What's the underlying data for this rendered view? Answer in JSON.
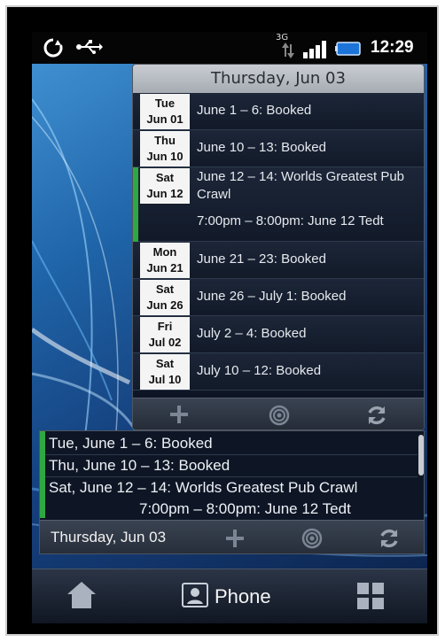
{
  "status_bar": {
    "network": "3G",
    "time": "12:29",
    "icons": [
      "sync-icon",
      "usb-icon",
      "data-arrows-icon",
      "signal-icon",
      "battery-icon"
    ]
  },
  "agenda_widget": {
    "header_date": "Thursday, Jun 03",
    "rows": [
      {
        "day": "Tue",
        "date": "Jun 01",
        "events": [
          "June 1 – 6: Booked"
        ]
      },
      {
        "day": "Thu",
        "date": "Jun 10",
        "events": [
          "June 10 – 13: Booked"
        ]
      },
      {
        "day": "Sat",
        "date": "Jun 12",
        "events": [
          "June 12 – 14: Worlds Greatest Pub",
          "Crawl",
          "7:00pm – 8:00pm: June 12 Tedt"
        ]
      },
      {
        "day": "Mon",
        "date": "Jun 21",
        "events": [
          "June 21 – 23: Booked"
        ]
      },
      {
        "day": "Sat",
        "date": "Jun 26",
        "events": [
          "June 26 – July 1: Booked"
        ]
      },
      {
        "day": "Fri",
        "date": "Jul 02",
        "events": [
          "July 2 – 4: Booked"
        ]
      },
      {
        "day": "Sat",
        "date": "Jul 10",
        "events": [
          "July 10 – 12: Booked"
        ]
      }
    ],
    "toolbar_icons": [
      "add-icon",
      "settings-icon",
      "refresh-icon"
    ]
  },
  "mini_widget": {
    "lines": [
      "Tue, June 1 – 6: Booked",
      "Thu, June 10 – 13: Booked",
      "Sat, June 12 – 14: Worlds Greatest Pub Crawl",
      "7:00pm – 8:00pm: June 12 Tedt"
    ],
    "footer_date": "Thursday, Jun 03",
    "toolbar_icons": [
      "add-icon",
      "settings-icon",
      "refresh-icon"
    ]
  },
  "dock": {
    "phone_label": "Phone",
    "icons": [
      "home-icon",
      "phone-contact-icon",
      "all-apps-icon"
    ]
  },
  "colors": {
    "accent_green": "#2fa843",
    "widget_bg": "#0e1626",
    "header_bg": "#b8bcc3"
  }
}
